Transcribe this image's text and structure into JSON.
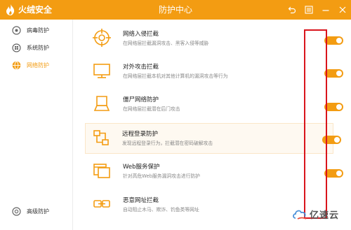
{
  "app": {
    "brand": "火绒安全",
    "window_title": "防护中心"
  },
  "colors": {
    "accent": "#f39c12",
    "highlight_border": "#d9141c"
  },
  "window_controls": [
    {
      "name": "back",
      "icon": "undo-icon"
    },
    {
      "name": "menu",
      "icon": "menu-icon"
    },
    {
      "name": "minimize",
      "icon": "minimize-icon"
    },
    {
      "name": "close",
      "icon": "close-icon"
    }
  ],
  "sidebar": {
    "items": [
      {
        "label": "病毒防护",
        "icon": "virus-shield-icon",
        "active": false
      },
      {
        "label": "系统防护",
        "icon": "windows-icon",
        "active": false
      },
      {
        "label": "网络防护",
        "icon": "globe-icon",
        "active": true
      }
    ],
    "bottom_item": {
      "label": "高级防护",
      "icon": "advanced-shield-icon"
    }
  },
  "features": [
    {
      "title": "网络入侵拦截",
      "desc": "在网络层拦截漏洞攻击、黑客入侵等威胁",
      "icon": "crosshair-icon",
      "enabled": true
    },
    {
      "title": "对外攻击拦截",
      "desc": "在网络层拦截本机对其他计算机的漏洞攻击等行为",
      "icon": "monitor-icon",
      "enabled": true
    },
    {
      "title": "僵尸网络防护",
      "desc": "在网络层拦截潜在后门攻击",
      "icon": "computer-icon",
      "enabled": true
    },
    {
      "title": "远程登录防护",
      "desc": "发现远程登录行为，拦截潜在密码破解攻击",
      "icon": "remote-login-icon",
      "enabled": true
    },
    {
      "title": "Web服务保护",
      "desc": "针对高危Web服务漏洞攻击进行防护",
      "icon": "web-window-icon",
      "enabled": true
    },
    {
      "title": "恶意网址拦截",
      "desc": "自动阻止木马、欺诈、钓鱼类等网址",
      "icon": "link-icon",
      "enabled": true
    }
  ],
  "watermark": {
    "text": "亿速云"
  }
}
